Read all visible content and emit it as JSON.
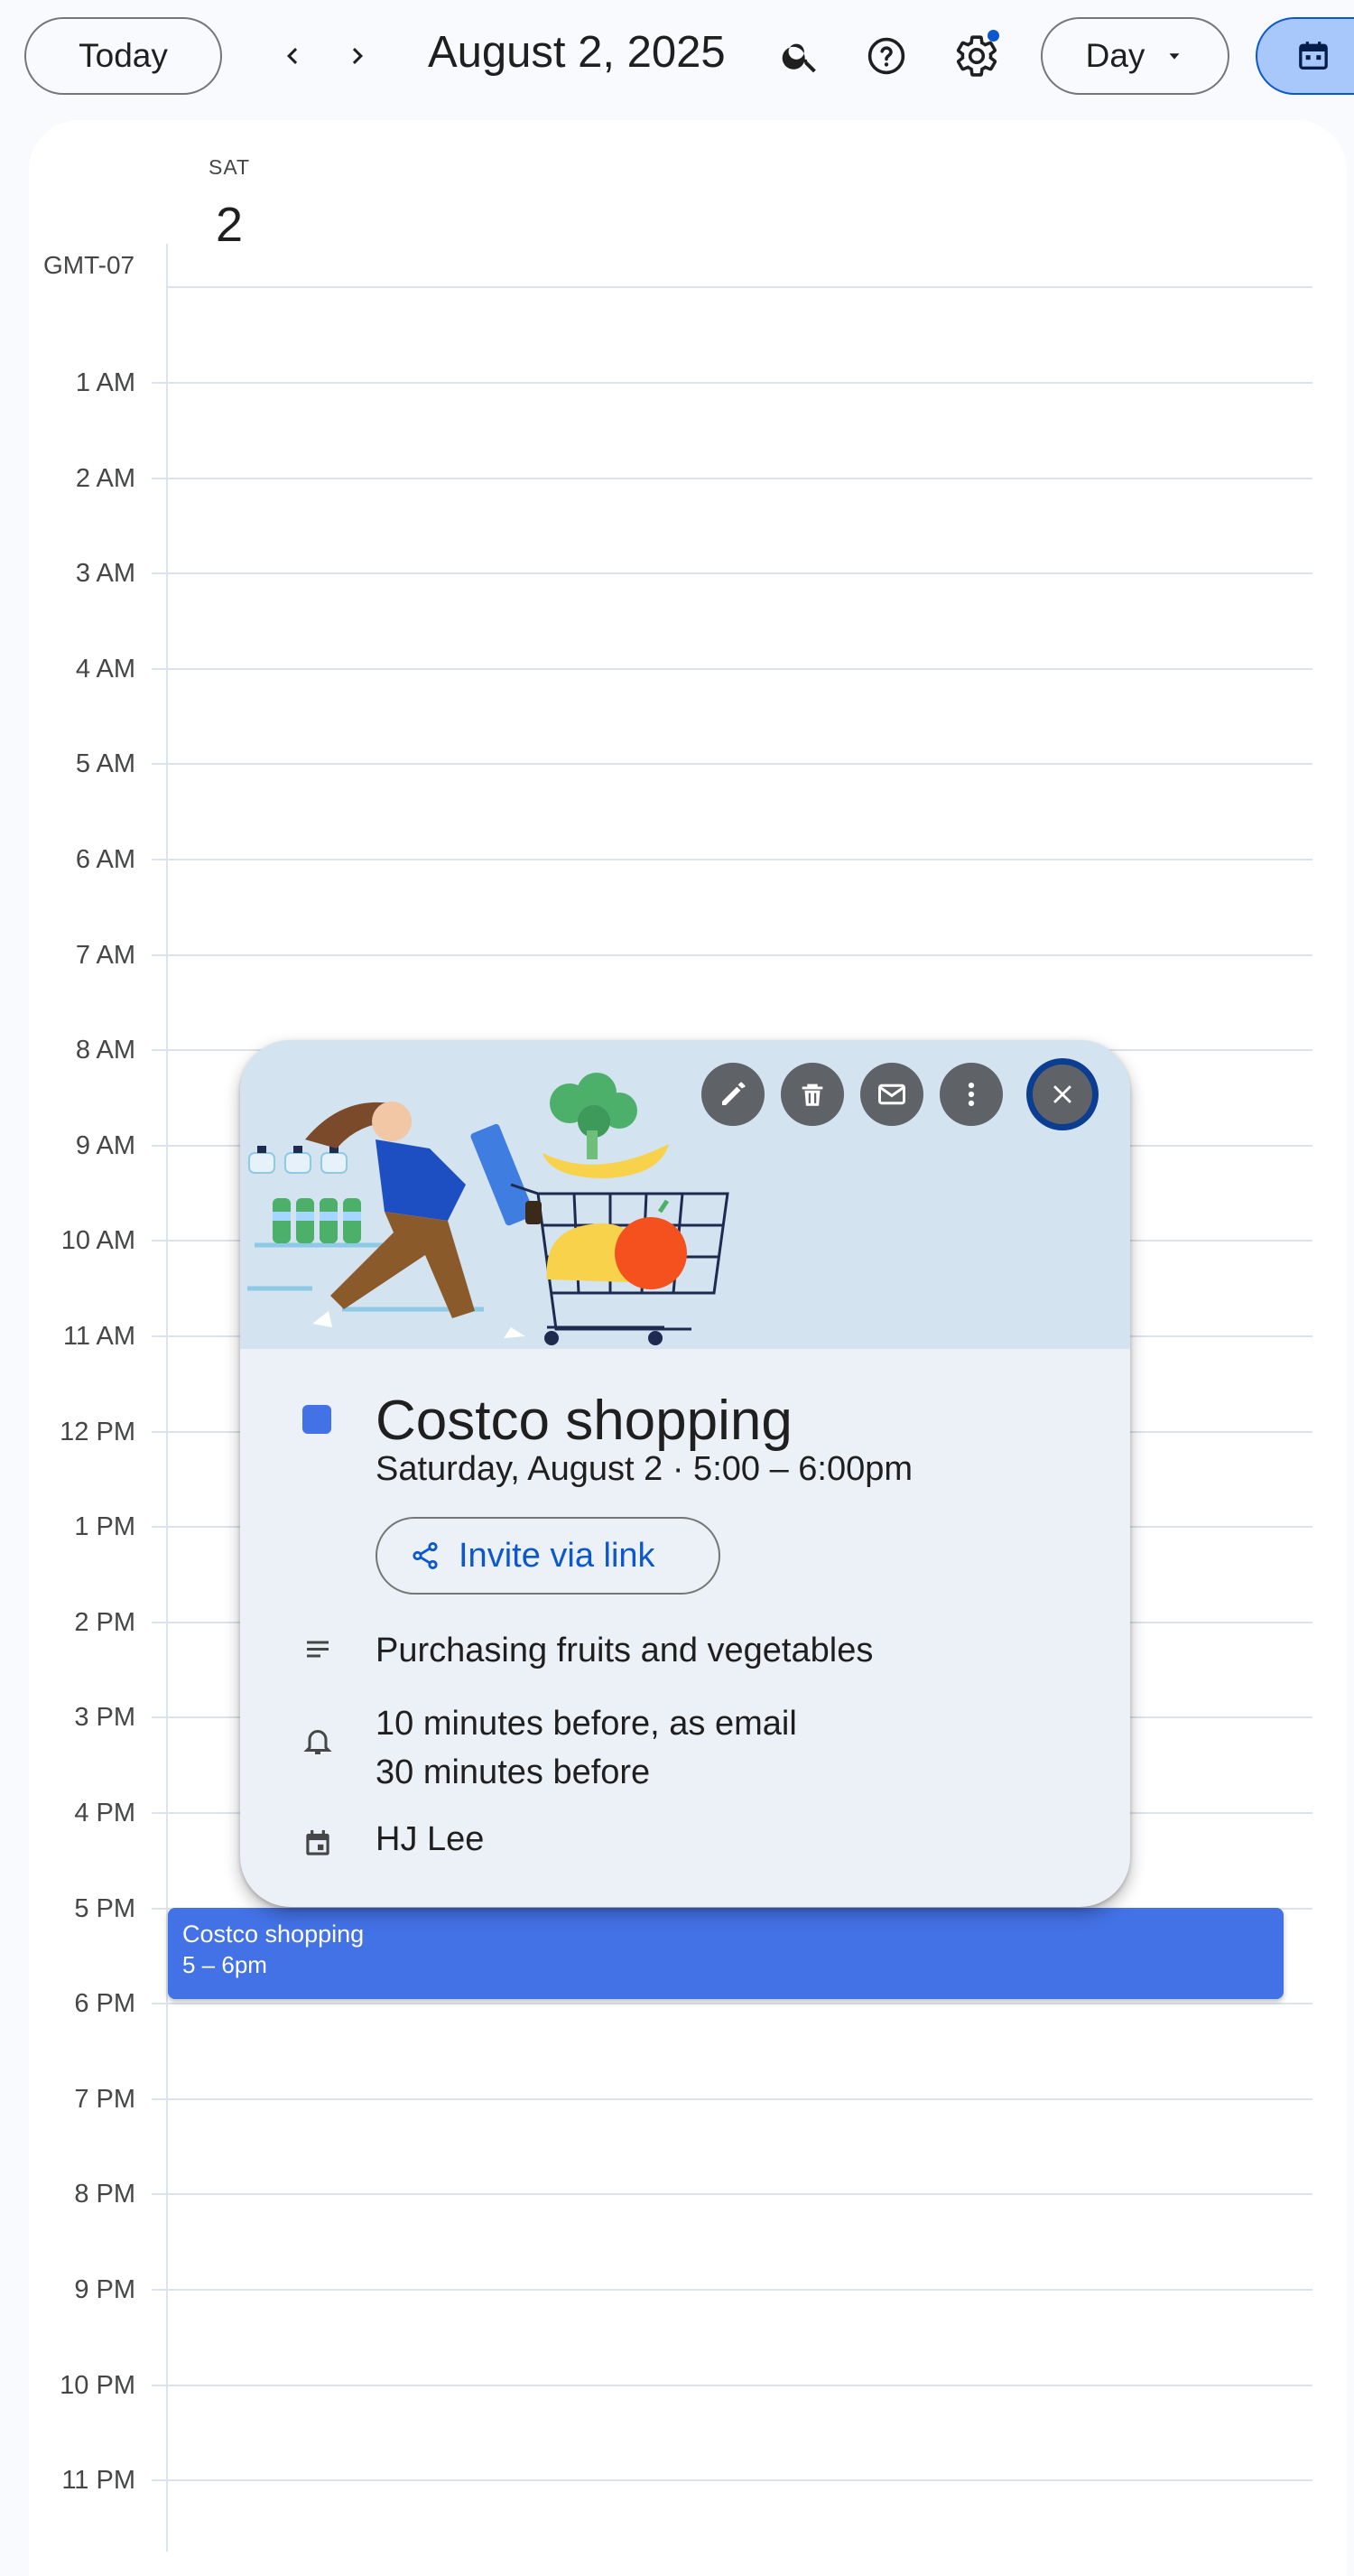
{
  "toolbar": {
    "today_label": "Today",
    "date_title": "August 2, 2025",
    "view_label": "Day",
    "settings_has_notification": true
  },
  "day_column": {
    "weekday": "SAT",
    "day_number": "2",
    "timezone": "GMT-07"
  },
  "hours": [
    "1 AM",
    "2 AM",
    "3 AM",
    "4 AM",
    "5 AM",
    "6 AM",
    "7 AM",
    "8 AM",
    "9 AM",
    "10 AM",
    "11 AM",
    "12 PM",
    "1 PM",
    "2 PM",
    "3 PM",
    "4 PM",
    "5 PM",
    "6 PM",
    "7 PM",
    "8 PM",
    "9 PM",
    "10 PM",
    "11 PM"
  ],
  "event_block": {
    "title": "Costco shopping",
    "time": "5 – 6pm",
    "color": "#4372e6"
  },
  "popup": {
    "title": "Costco shopping",
    "datetime": "Saturday, August 2  ·  5:00 – 6:00pm",
    "invite_label": "Invite via link",
    "description": "Purchasing fruits and vegetables",
    "reminders": [
      "10 minutes before, as email",
      "30 minutes before"
    ],
    "calendar_owner": "HJ Lee",
    "actions": [
      "edit-icon",
      "delete-icon",
      "email-icon",
      "more-vert-icon",
      "close-icon"
    ]
  },
  "colors": {
    "accent": "#0b57d0",
    "event": "#4372e6",
    "popup_bg": "#ecf0f7",
    "header_bg": "#d3e3f0"
  }
}
